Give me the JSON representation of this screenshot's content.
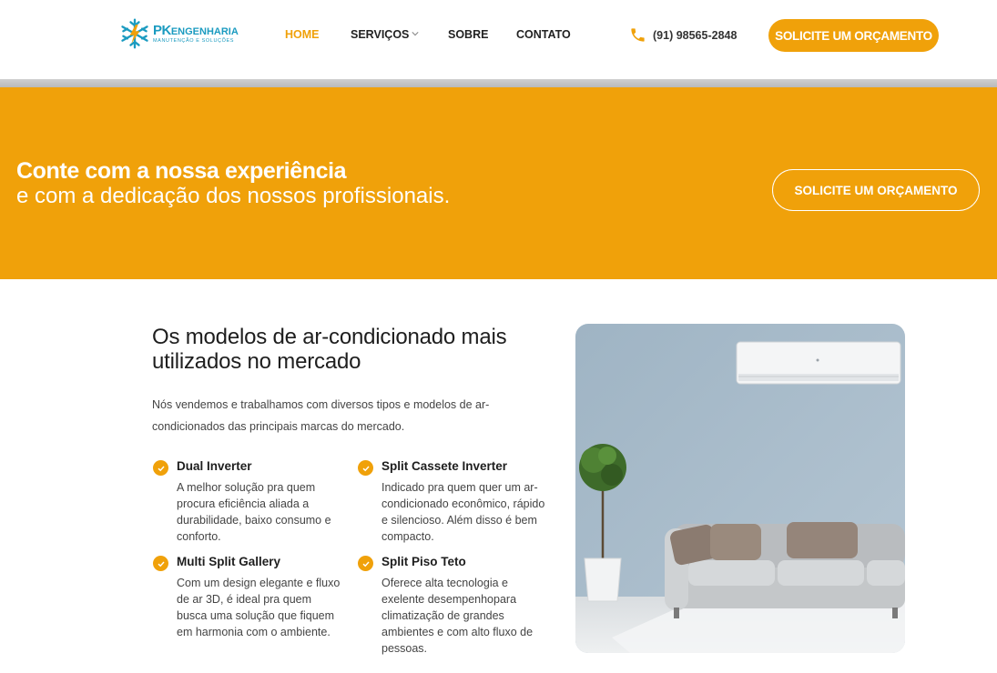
{
  "brand": {
    "logo_main": "PK",
    "logo_eng": "ENGENHARIA",
    "logo_sub": "MANUTENÇÃO E SOLUÇÕES"
  },
  "nav": {
    "items": [
      {
        "label": "HOME",
        "active": true
      },
      {
        "label": "SERVIÇOS",
        "active": false,
        "has_dropdown": true
      },
      {
        "label": "SOBRE",
        "active": false
      },
      {
        "label": "CONTATO",
        "active": false
      }
    ]
  },
  "header": {
    "phone": "(91) 98565-2848",
    "cta_label": "SOLICITE UM ORÇAMENTO"
  },
  "banner": {
    "title": "Conte com a nossa experiência",
    "subtitle": "e com a dedicação dos nossos profissionais.",
    "cta_label": "SOLICITE UM ORÇAMENTO"
  },
  "section": {
    "title": "Os modelos de ar-condicionado mais utilizados no mercado",
    "intro": "Nós vendemos e trabalhamos com diversos tipos e modelos de ar-condicionados das principais marcas do mercado.",
    "features": [
      {
        "title": "Dual Inverter",
        "desc": "A melhor solução pra quem procura eficiência aliada a durabilidade, baixo consumo e conforto."
      },
      {
        "title": "Split Cassete Inverter",
        "desc": "Indicado pra quem quer um ar-condicionado econômico, rápido e silencioso. Além disso é bem compacto."
      },
      {
        "title": "Multi Split Gallery",
        "desc": "Com um design elegante e fluxo de ar 3D, é ideal pra quem busca uma solução que fiquem em harmonia com o ambiente."
      },
      {
        "title": "Split Piso Teto",
        "desc": "Oferece alta tecnologia e exelente desempenhopara climatização de grandes ambientes e com alto fluxo de pessoas."
      }
    ]
  },
  "colors": {
    "accent": "#f0a10a",
    "brand_blue": "#1b9bc0",
    "wall": "#a9bccb"
  },
  "icons": {
    "logo": "snowflake-lightning-icon",
    "phone": "phone-icon",
    "check": "check-circle-icon",
    "dropdown": "chevron-down-icon"
  }
}
